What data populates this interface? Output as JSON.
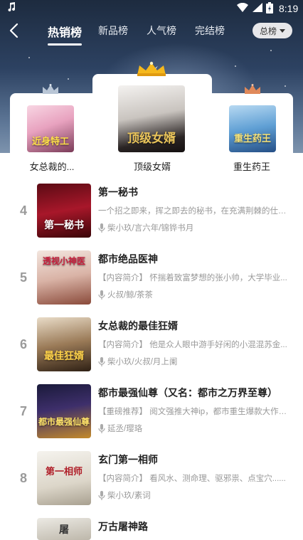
{
  "status_bar": {
    "time": "8:19"
  },
  "nav": {
    "tabs": [
      {
        "label": "热销榜",
        "active": true
      },
      {
        "label": "新品榜",
        "active": false
      },
      {
        "label": "人气榜",
        "active": false
      },
      {
        "label": "完结榜",
        "active": false
      }
    ],
    "dropdown_label": "总榜"
  },
  "top3": [
    {
      "rank": 2,
      "title": "女总裁的...",
      "cover_text": "近身特工",
      "crown_color": "#b9c6d6"
    },
    {
      "rank": 1,
      "title": "顶级女婿",
      "cover_text": "顶级女婿",
      "crown_color": "#f5b81c"
    },
    {
      "rank": 3,
      "title": "重生药王",
      "cover_text": "重生药王",
      "crown_color": "#e0895a"
    }
  ],
  "list": [
    {
      "rank": "4",
      "title": "第一秘书",
      "intro": "一个招之即来，挥之即去的秘书，在充满荆棘的仕途...",
      "anchors": "柴小玖/言六年/锦铧书月",
      "cover_text": "第一秘书"
    },
    {
      "rank": "5",
      "title": "都市绝品医神",
      "intro": "【内容简介】 怀揣着致富梦想的张小帅，大学毕业...",
      "anchors": "火叔/鲸/茶茶",
      "cover_text": "透视小神医"
    },
    {
      "rank": "6",
      "title": "女总裁的最佳狂婿",
      "intro": "【内容简介】 他是众人眼中游手好闲的小混混苏金...",
      "anchors": "柴小玖/火叔/月上阑",
      "cover_text": "最佳狂婿"
    },
    {
      "rank": "7",
      "title": "都市最强仙尊（又名：都市之万界至尊）",
      "intro": "【重磅推荐】 阅文强推大神ip，都市重生爆款大作！...",
      "anchors": "延丞/璎珞",
      "cover_text": "都市最强仙尊"
    },
    {
      "rank": "8",
      "title": "玄门第一相师",
      "intro": "【内容简介】 看风水、测命理、驱邪祟、点宝穴......",
      "anchors": "柴小玖/素词",
      "cover_text": "第一相师"
    },
    {
      "rank": "",
      "title": "万古屠神路",
      "intro": "",
      "anchors": "",
      "cover_text": "屠"
    }
  ]
}
